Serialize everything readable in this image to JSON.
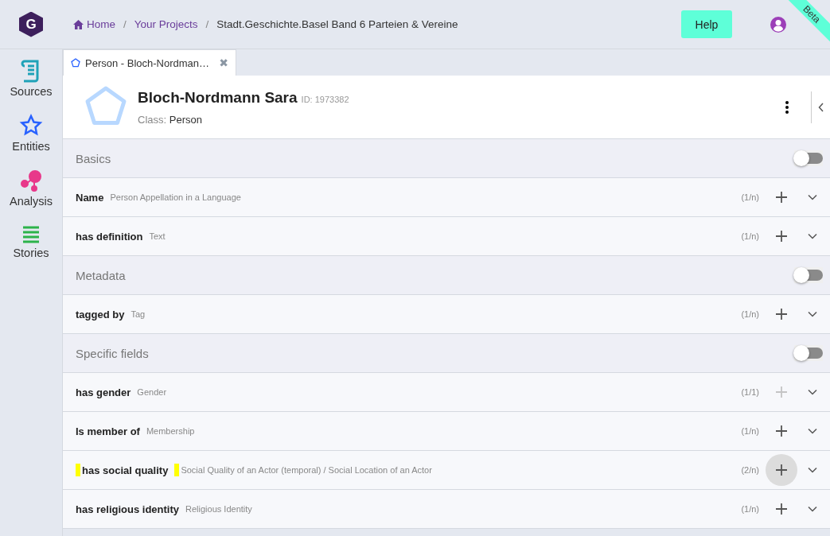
{
  "logo": "G",
  "breadcrumbs": [
    {
      "label": "Home",
      "kind": "link"
    },
    {
      "label": "Your Projects",
      "kind": "link"
    },
    {
      "label": "Stadt.Geschichte.Basel Band 6 Parteien & Vereine",
      "kind": "current"
    }
  ],
  "breadcrumb_separators": [
    "/",
    "/"
  ],
  "help_button": "Help",
  "ribbon": "Beta",
  "sidebar": {
    "items": [
      {
        "label": "Sources",
        "kind": "sources"
      },
      {
        "label": "Entities",
        "kind": "entities"
      },
      {
        "label": "Analysis",
        "kind": "analysis"
      },
      {
        "label": "Stories",
        "kind": "stories"
      }
    ]
  },
  "tabs": [
    {
      "label": "Person - Bloch-Nordman…",
      "selected": true,
      "close": "✖"
    }
  ],
  "entity": {
    "name": "Bloch-Nordmann Sara",
    "id_label": "ID:",
    "id": "1973382",
    "class_label": "Class:",
    "class": "Person"
  },
  "rows": [
    {
      "kind": "section",
      "label": "Basics",
      "on": false
    },
    {
      "kind": "field",
      "label": "Name",
      "range": "Person Appellation in a Language",
      "count": "(1/n)",
      "add_disabled": false,
      "highlighted": false,
      "hovered": false
    },
    {
      "kind": "field",
      "label": "has definition",
      "range": "Text",
      "count": "(1/n)",
      "add_disabled": false,
      "highlighted": false,
      "hovered": false
    },
    {
      "kind": "section",
      "label": "Metadata",
      "on": false
    },
    {
      "kind": "field",
      "label": "tagged by",
      "range": "Tag",
      "count": "(1/n)",
      "add_disabled": false,
      "highlighted": false,
      "hovered": false
    },
    {
      "kind": "section",
      "label": "Specific fields",
      "on": false
    },
    {
      "kind": "field",
      "label": "has gender",
      "range": "Gender",
      "count": "(1/1)",
      "add_disabled": true,
      "highlighted": false,
      "hovered": false
    },
    {
      "kind": "field",
      "label": "Is member of",
      "range": "Membership",
      "count": "(1/n)",
      "add_disabled": false,
      "highlighted": false,
      "hovered": false
    },
    {
      "kind": "field",
      "label": "has social quality",
      "range": "Social Quality of an Actor (temporal) / Social Location of an Actor",
      "count": "(2/n)",
      "add_disabled": false,
      "highlighted": true,
      "hovered": true
    },
    {
      "kind": "field",
      "label": "has religious identity",
      "range": "Religious Identity",
      "count": "(1/n)",
      "add_disabled": false,
      "highlighted": false,
      "hovered": false
    }
  ]
}
